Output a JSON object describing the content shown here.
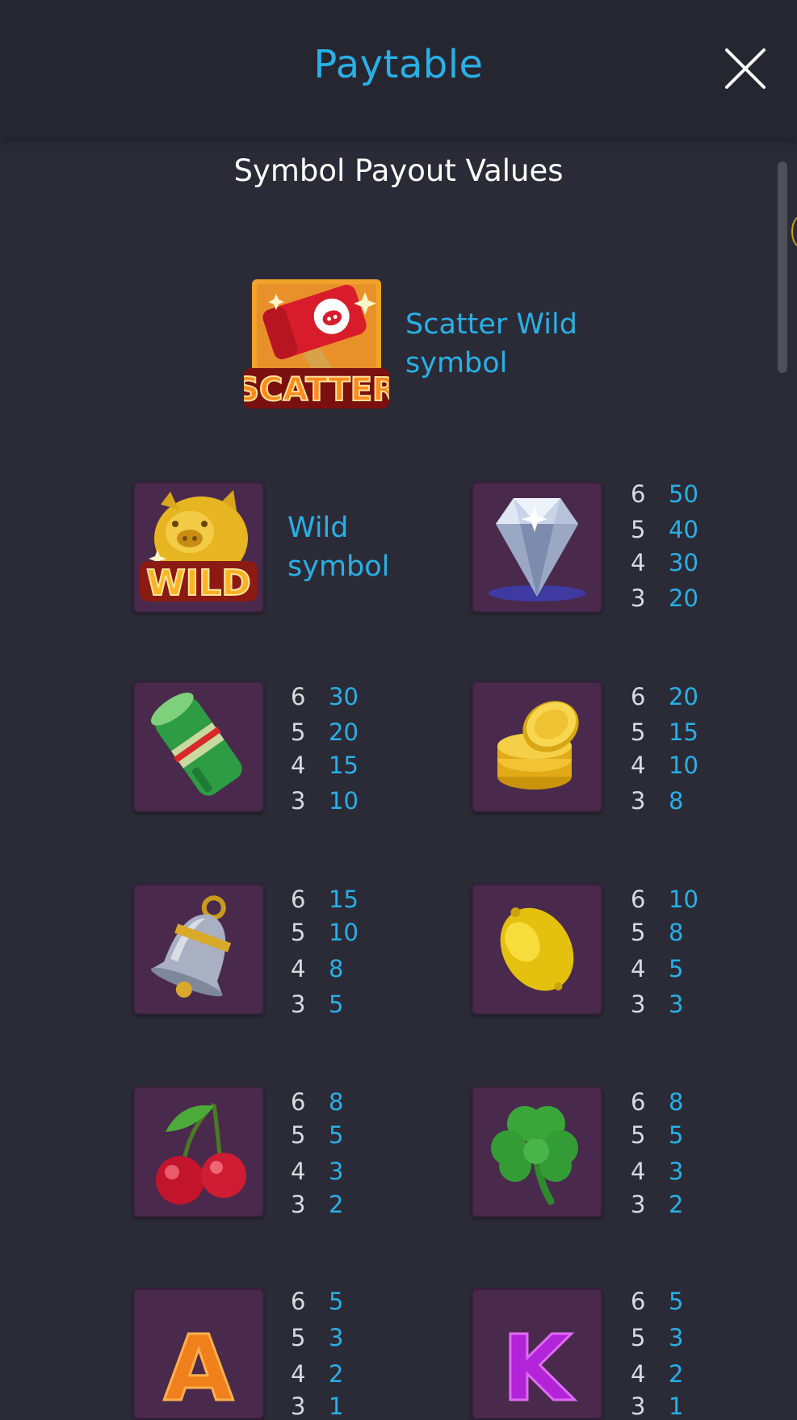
{
  "header": {
    "title": "Paytable"
  },
  "section": {
    "title": "Symbol Payout Values"
  },
  "scatter": {
    "icon": "scatter-hammer-icon",
    "label_line1": "Scatter Wild",
    "label_line2": "symbol",
    "badge": "SCATTER"
  },
  "wild": {
    "icon": "golden-pig-wild-icon",
    "label_line1": "Wild",
    "label_line2": "symbol",
    "badge": "WILD"
  },
  "symbols": [
    {
      "name": "diamond",
      "icon": "diamond-icon",
      "payouts": [
        {
          "count": "6",
          "value": "50"
        },
        {
          "count": "5",
          "value": "40"
        },
        {
          "count": "4",
          "value": "30"
        },
        {
          "count": "3",
          "value": "20"
        }
      ]
    },
    {
      "name": "cash-roll",
      "icon": "cash-roll-icon",
      "payouts": [
        {
          "count": "6",
          "value": "30"
        },
        {
          "count": "5",
          "value": "20"
        },
        {
          "count": "4",
          "value": "15"
        },
        {
          "count": "3",
          "value": "10"
        }
      ]
    },
    {
      "name": "gold-coins",
      "icon": "gold-coins-icon",
      "payouts": [
        {
          "count": "6",
          "value": "20"
        },
        {
          "count": "5",
          "value": "15"
        },
        {
          "count": "4",
          "value": "10"
        },
        {
          "count": "3",
          "value": "8"
        }
      ]
    },
    {
      "name": "bell",
      "icon": "bell-icon",
      "payouts": [
        {
          "count": "6",
          "value": "15"
        },
        {
          "count": "5",
          "value": "10"
        },
        {
          "count": "4",
          "value": "8"
        },
        {
          "count": "3",
          "value": "5"
        }
      ]
    },
    {
      "name": "lemon",
      "icon": "lemon-icon",
      "payouts": [
        {
          "count": "6",
          "value": "10"
        },
        {
          "count": "5",
          "value": "8"
        },
        {
          "count": "4",
          "value": "5"
        },
        {
          "count": "3",
          "value": "3"
        }
      ]
    },
    {
      "name": "cherries",
      "icon": "cherries-icon",
      "payouts": [
        {
          "count": "6",
          "value": "8"
        },
        {
          "count": "5",
          "value": "5"
        },
        {
          "count": "4",
          "value": "3"
        },
        {
          "count": "3",
          "value": "2"
        }
      ]
    },
    {
      "name": "clover",
      "icon": "clover-icon",
      "payouts": [
        {
          "count": "6",
          "value": "8"
        },
        {
          "count": "5",
          "value": "5"
        },
        {
          "count": "4",
          "value": "3"
        },
        {
          "count": "3",
          "value": "2"
        }
      ]
    },
    {
      "name": "letter-a",
      "icon": "letter-a-icon",
      "letter": "A",
      "payouts": [
        {
          "count": "6",
          "value": "5"
        },
        {
          "count": "5",
          "value": "3"
        },
        {
          "count": "4",
          "value": "2"
        },
        {
          "count": "3",
          "value": "1"
        }
      ]
    },
    {
      "name": "letter-k",
      "icon": "letter-k-icon",
      "letter": "K",
      "payouts": [
        {
          "count": "6",
          "value": "5"
        },
        {
          "count": "5",
          "value": "3"
        },
        {
          "count": "4",
          "value": "2"
        },
        {
          "count": "3",
          "value": "1"
        }
      ]
    }
  ],
  "colors": {
    "accent": "#29b0e6",
    "background": "#2b2b37",
    "header": "#262631",
    "tile": "#4a2a4c",
    "text": "#ffffff"
  }
}
